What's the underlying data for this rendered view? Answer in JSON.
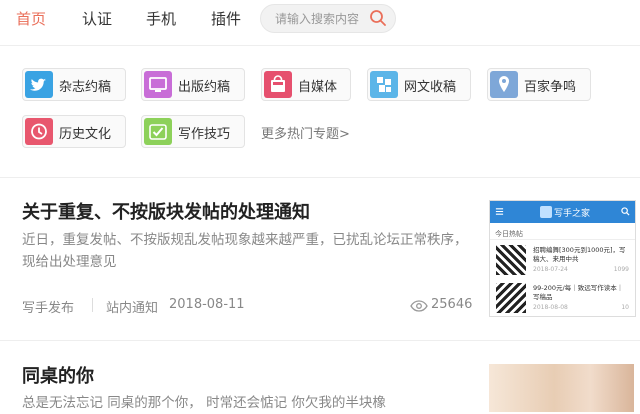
{
  "nav": {
    "items": [
      {
        "label": "首页",
        "active": true
      },
      {
        "label": "认证",
        "active": false
      },
      {
        "label": "手机",
        "active": false
      },
      {
        "label": "插件",
        "active": false
      }
    ],
    "search_placeholder": "请输入搜索内容"
  },
  "topics": [
    {
      "label": "杂志约稿",
      "icon": "twitter-bird-icon",
      "color": "#3aa3e3"
    },
    {
      "label": "出版约稿",
      "icon": "monitor-icon",
      "color": "#c86dd7"
    },
    {
      "label": "自媒体",
      "icon": "shopping-bag-icon",
      "color": "#e6506e"
    },
    {
      "label": "网文收稿",
      "icon": "stack-icon",
      "color": "#5bb5e8"
    },
    {
      "label": "百家争鸣",
      "icon": "location-pin-icon",
      "color": "#7ea7d8"
    },
    {
      "label": "历史文化",
      "icon": "clock-icon",
      "color": "#e8576e"
    },
    {
      "label": "写作技巧",
      "icon": "check-pen-icon",
      "color": "#8dd15a"
    }
  ],
  "more_topics": "更多热门专题>",
  "articles": [
    {
      "title": "关于重复、不按版块发帖的处理通知",
      "abstract": "近日，重复发帖、不按版规乱发帖现象越来越严重，已扰乱论坛正常秩序，现给出处理意见",
      "author": "写手发布",
      "category": "站内通知",
      "date": "2018-08-11",
      "views": "25646",
      "thumb": {
        "app_title": "写手之家",
        "section": "今日热帖",
        "post1_title": "招聘编舞[300元到1000元]，写稿大、来用中共",
        "post1_date": "2018-07-24",
        "post1_count": "1099",
        "post2_title": "99-200元/每｜致远写作读本｜写稿品",
        "post2_date": "2018-08-08",
        "post2_count": "10"
      }
    },
    {
      "title": "同桌的你",
      "abstract": "总是无法忘记 同桌的那个你， 时常还会惦记 你欠我的半块橡"
    }
  ]
}
